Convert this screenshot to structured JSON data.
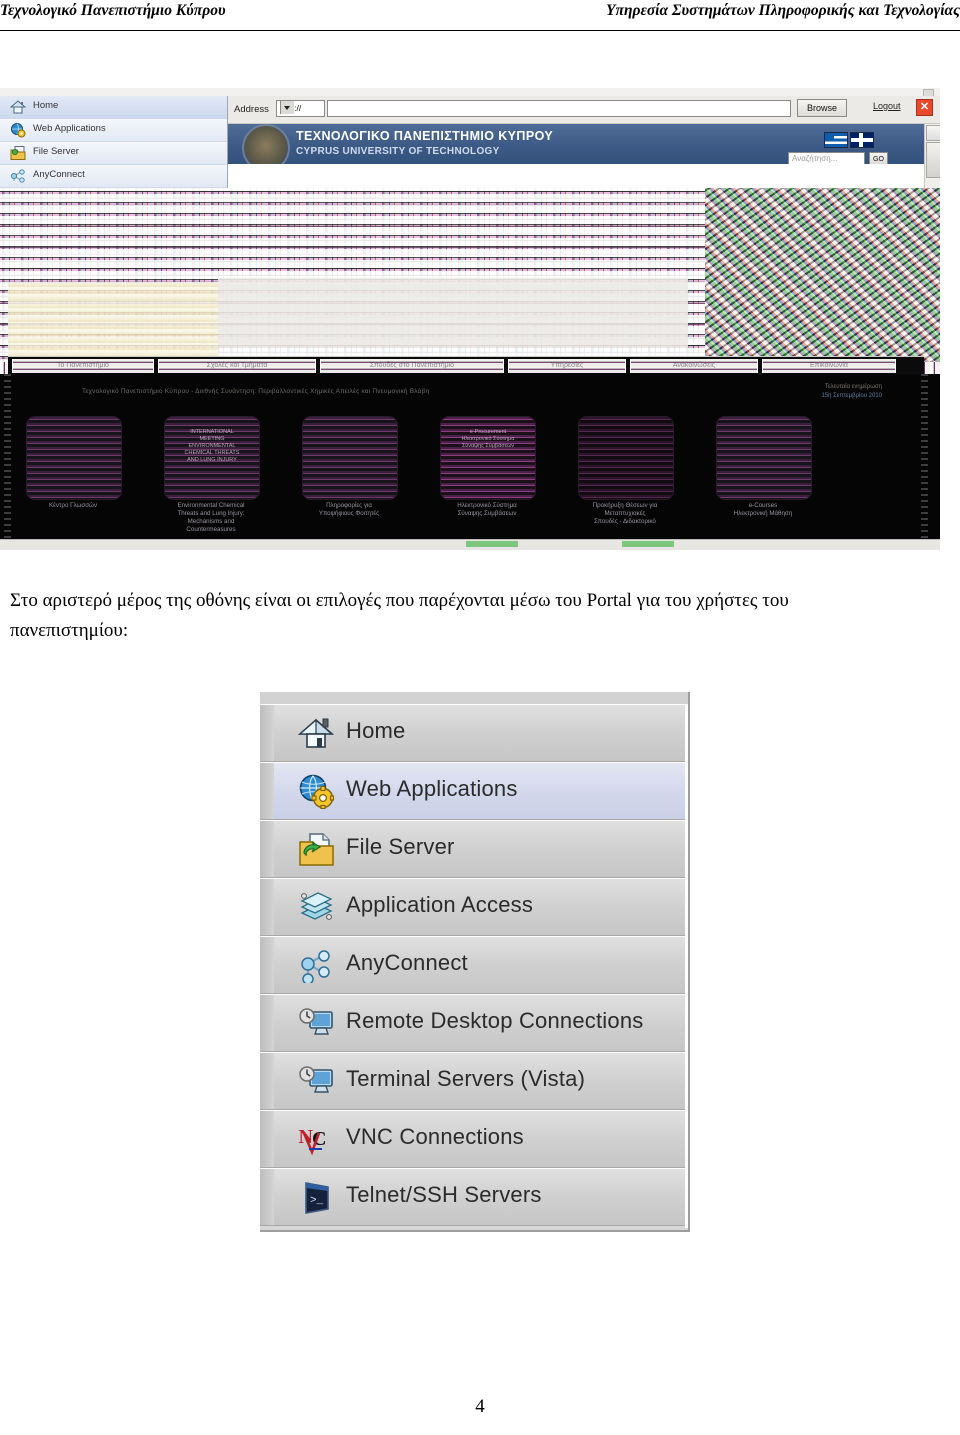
{
  "page": {
    "header_left": "Τεχνολογικό Πανεπιστήμιο Κύπρου",
    "header_right": "Υπηρεσία Συστημάτων Πληροφορικής και Τεχνολογίας",
    "paragraph": "Στο αριστερό μέρος της οθόνης είναι οι επιλογές που παρέχονται μέσω του Portal για του χρήστες του πανεπιστημίου:",
    "page_number": "4"
  },
  "screenshot": {
    "sidebar": {
      "items": [
        {
          "label": "Home",
          "icon": "home-icon",
          "active": true
        },
        {
          "label": "Web Applications",
          "icon": "globe-gear-icon",
          "active": false
        },
        {
          "label": "File Server",
          "icon": "folder-file-icon",
          "active": false
        },
        {
          "label": "AnyConnect",
          "icon": "network-nodes-icon",
          "active": false
        }
      ]
    },
    "address_bar": {
      "label": "Address",
      "protocol_value": "http://",
      "url_value": "",
      "browse_label": "Browse",
      "logout_label": "Logout",
      "close_label": "✕"
    },
    "banner": {
      "title_gr": "ΤΕΧΝΟΛΟΓΙΚΟ ΠΑΝΕΠΙΣΤΗΜΙΟ ΚΥΠΡΟΥ",
      "title_en": "CYPRUS UNIVERSITY OF TECHNOLOGY",
      "search_placeholder": "Αναζήτηση...",
      "go_label": "GO",
      "flags": [
        "flag-greece-icon",
        "flag-uk-icon"
      ]
    },
    "navbar_items": [
      "Το Πανεπιστήμιο",
      "Σχολές και Τμήματα",
      "Σπουδές στο Πανεπιστήμιο",
      "Υπηρεσίες",
      "Ανακοινώσεις",
      "Επικοινωνία"
    ],
    "logo_strip": {
      "headline": "Τεχνολογικό Πανεπιστήμιο Κύπρου - Διεθνής Συνάντηση: Περιβαλλοντικές Χημικές Απειλές και Πνευμονική Βλάβη",
      "right_line1": "Τελευταία ενημέρωση",
      "right_line2": "15η Σεπτεμβρίου 2010",
      "tiles": [
        {
          "caption": "Κέντρο Γλωσσών",
          "inner": "",
          "glyph": "photo-tile-icon"
        },
        {
          "caption": "Environmental Chemical\nThreats and Lung Injury:\nMechanisms and\nCountermeasures",
          "inner": "INTERNATIONAL\nMEETING\nENVIRONMENTAL\nCHEMICAL THREATS\nAND LUNG INJURY",
          "glyph": "poster-tile-icon"
        },
        {
          "caption": "Πληροφορίες για\nΥποψήφιους Φοιτητές",
          "inner": "",
          "glyph": "brochure-tile-icon"
        },
        {
          "caption": "Ηλεκτρονικό Σύστημα\nΣύναψης Συμβάσεων",
          "inner": "e-Procurement\nΗλεκτρονικό Σύστημα\nΣύναψης Συμβάσεων",
          "glyph": "star-tile-icon"
        },
        {
          "caption": "Προκήρυξη Θέσεων για\nΜεταπτυχιακές\nΣπουδές - Διδακτορικό",
          "inner": "",
          "glyph": "burst-tile-icon"
        },
        {
          "caption": "e-Courses\nΗλεκτρονική Μάθηση",
          "inner": "",
          "glyph": "moodle-tile-icon"
        }
      ]
    }
  },
  "menu_figure": {
    "items": [
      {
        "label": "Home",
        "icon": "home-icon",
        "selected": false
      },
      {
        "label": "Web Applications",
        "icon": "globe-gear-icon",
        "selected": true
      },
      {
        "label": "File Server",
        "icon": "folder-file-icon",
        "selected": false
      },
      {
        "label": "Application Access",
        "icon": "layers-icon",
        "selected": false
      },
      {
        "label": "AnyConnect",
        "icon": "network-nodes-icon",
        "selected": false
      },
      {
        "label": "Remote Desktop Connections",
        "icon": "monitor-clock-icon",
        "selected": false
      },
      {
        "label": "Terminal Servers (Vista)",
        "icon": "monitor-clock-icon",
        "selected": false
      },
      {
        "label": "VNC Connections",
        "icon": "vnc-logo-icon",
        "selected": false
      },
      {
        "label": "Telnet/SSH Servers",
        "icon": "terminal-icon",
        "selected": false
      }
    ]
  },
  "colors": {
    "banner_blue": "#3c5a85",
    "selected_row": "#d4d8ec",
    "close_red": "#e8492c",
    "vnc_red": "#c0202a"
  }
}
